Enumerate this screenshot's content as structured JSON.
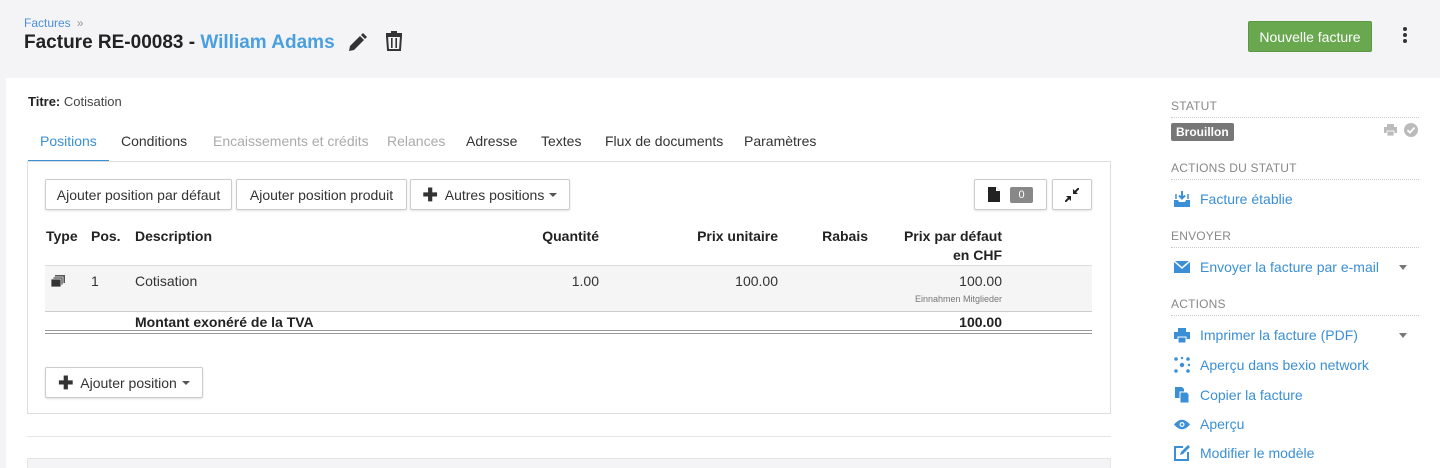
{
  "breadcrumb": {
    "label": "Factures",
    "separator": "»"
  },
  "header": {
    "title_prefix": "Facture RE-00083 - ",
    "contact_name": "William Adams",
    "new_button": "Nouvelle facture"
  },
  "titre": {
    "label": "Titre:",
    "value": "Cotisation"
  },
  "tabs": [
    {
      "label": "Positions",
      "state": "active"
    },
    {
      "label": "Conditions",
      "state": "normal"
    },
    {
      "label": "Encaissements et crédits",
      "state": "disabled"
    },
    {
      "label": "Relances",
      "state": "disabled"
    },
    {
      "label": "Adresse",
      "state": "normal"
    },
    {
      "label": "Textes",
      "state": "normal"
    },
    {
      "label": "Flux de documents",
      "state": "normal"
    },
    {
      "label": "Paramètres",
      "state": "normal"
    }
  ],
  "toolbar": {
    "add_default": "Ajouter position par défaut",
    "add_product": "Ajouter position produit",
    "other_positions": "Autres positions",
    "doc_count": "0"
  },
  "table": {
    "headers": {
      "type": "Type",
      "pos": "Pos.",
      "description": "Description",
      "quantity": "Quantité",
      "unit_price": "Prix unitaire",
      "discount": "Rabais",
      "default_price_line1": "Prix par défaut",
      "default_price_line2": "en CHF"
    },
    "rows": [
      {
        "pos": "1",
        "description": "Cotisation",
        "quantity": "1.00",
        "unit_price": "100.00",
        "default_price": "100.00",
        "account": "Einnahmen Mitglieder"
      }
    ],
    "summary": {
      "label": "Montant exonéré de la TVA",
      "value": "100.00"
    }
  },
  "add_position": "Ajouter position",
  "sidebar": {
    "statut_heading": "STATUT",
    "status_badge": "Brouillon",
    "status_actions_heading": "ACTIONS DU STATUT",
    "status_action": "Facture établie",
    "send_heading": "ENVOYER",
    "send_email": "Envoyer la facture par e-mail",
    "actions_heading": "ACTIONS",
    "actions": [
      "Imprimer la facture (PDF)",
      "Aperçu dans bexio network",
      "Copier la facture",
      "Aperçu",
      "Modifier le modèle"
    ]
  },
  "colors": {
    "accent": "#3a8fd6",
    "primary_button": "#6aa84f",
    "status_badge": "#777777"
  }
}
